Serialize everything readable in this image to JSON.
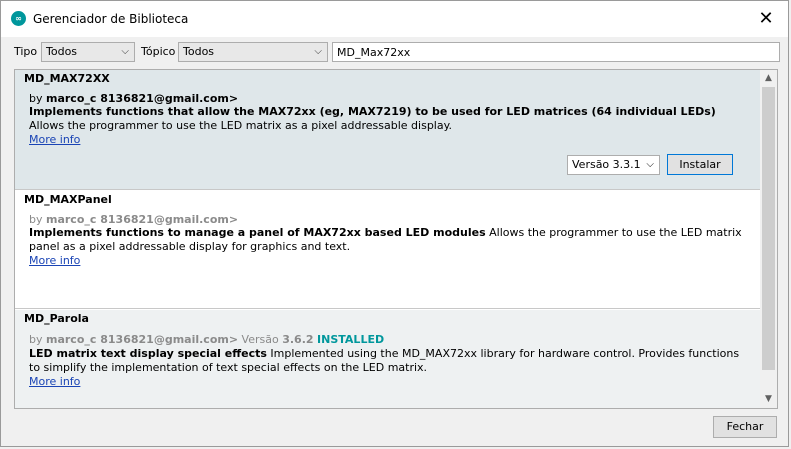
{
  "window": {
    "title": "Gerenciador de Biblioteca",
    "close_symbol": "✕"
  },
  "filters": {
    "tipo_label": "Tipo",
    "tipo_value": "Todos",
    "topico_label": "Tópico",
    "topico_value": "Todos",
    "search_value": "MD_Max72xx"
  },
  "libraries": [
    {
      "name": "MD_MAX72XX",
      "by_prefix": "by ",
      "author": "marco_c 8136821@gmail.com>",
      "desc_bold": "Implements functions that allow the MAX72xx (eg, MAX7219) to be used for LED matrices (64 individual LEDs)",
      "desc_rest": " Allows the programmer to use the LED matrix as a pixel addressable display.",
      "more_info": "More info",
      "version_option": "Versão 3.3.1",
      "install_label": "Instalar"
    },
    {
      "name": "MD_MAXPanel",
      "by_prefix": "by ",
      "author": "marco_c 8136821@gmail.com>",
      "desc_bold": "Implements functions to manage a panel of MAX72xx based LED modules",
      "desc_rest": " Allows the programmer to use the LED matrix panel as a pixel addressable display for graphics and text.",
      "more_info": "More info"
    },
    {
      "name": "MD_Parola",
      "by_prefix": "by ",
      "author": "marco_c 8136821@gmail.com>",
      "version_prefix": " Versão ",
      "version": "3.6.2",
      "installed": "INSTALLED",
      "desc_bold": "LED matrix text display special effects",
      "desc_rest": " Implemented using the MD_MAX72xx library for hardware control. Provides functions to simplify the implementation of text special effects on the LED matrix.",
      "more_info": "More info"
    }
  ],
  "footer": {
    "close_label": "Fechar"
  }
}
